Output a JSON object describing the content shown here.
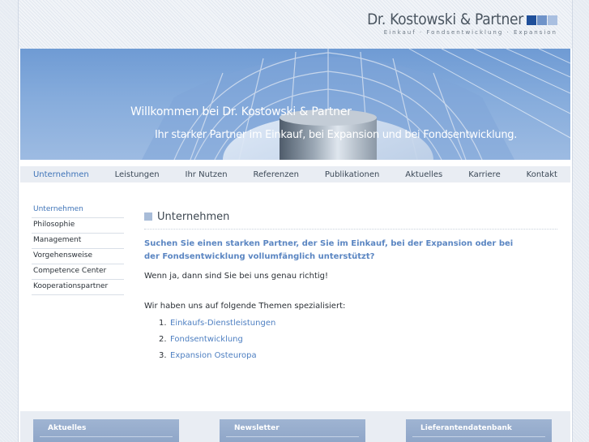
{
  "header": {
    "logo_title": "Dr. Kostowski & Partner",
    "logo_tagline": "Einkauf · Fondsentwicklung · Expansion",
    "logo_colors": [
      "#1f4f9a",
      "#6f93c9",
      "#a9bfe0"
    ]
  },
  "banner": {
    "title": "Willkommen bei Dr. Kostowski & Partner",
    "subtitle": "Ihr starker Partner im Einkauf, bei Expansion und bei Fondsentwicklung."
  },
  "nav": {
    "items": [
      {
        "label": "Unternehmen",
        "active": true
      },
      {
        "label": "Leistungen"
      },
      {
        "label": "Ihr Nutzen"
      },
      {
        "label": "Referenzen"
      },
      {
        "label": "Publikationen"
      },
      {
        "label": "Aktuelles"
      },
      {
        "label": "Karriere"
      },
      {
        "label": "Kontakt"
      }
    ]
  },
  "sidenav": {
    "items": [
      {
        "label": "Unternehmen",
        "active": true
      },
      {
        "label": "Philosophie"
      },
      {
        "label": "Management"
      },
      {
        "label": "Vorgehensweise"
      },
      {
        "label": "Competence Center"
      },
      {
        "label": "Kooperationspartner"
      }
    ]
  },
  "content": {
    "heading": "Unternehmen",
    "lead": "Suchen Sie einen starken Partner, der Sie im Einkauf, bei der Expansion oder bei der Fondsentwicklung vollumfänglich unterstützt?",
    "paragraph1": "Wenn ja, dann sind Sie bei uns genau richtig!",
    "paragraph2": "Wir haben uns auf folgende Themen spezialisiert:",
    "topics": [
      {
        "num": "1.",
        "label": "Einkaufs-Dienstleistungen"
      },
      {
        "num": "2.",
        "label": "Fondsentwicklung"
      },
      {
        "num": "3.",
        "label": "Expansion Osteuropa"
      }
    ]
  },
  "footer": {
    "boxes": [
      {
        "label": "Aktuelles"
      },
      {
        "label": "Newsletter"
      },
      {
        "label": "Lieferantendatenbank"
      }
    ]
  },
  "colors": {
    "accent": "#3f74b8",
    "link": "#4f80c2",
    "lead": "#5b86c2",
    "box": "#9fb4d2"
  }
}
